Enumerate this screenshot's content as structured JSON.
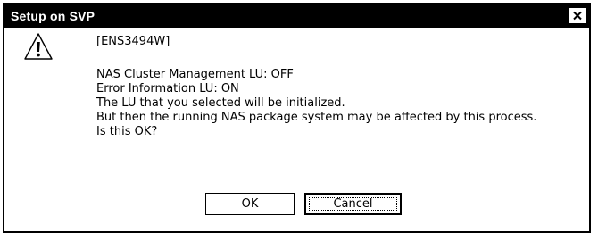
{
  "window": {
    "title": "Setup on SVP",
    "close_icon": "close-icon"
  },
  "message": {
    "icon": "warning-icon",
    "code": "[ENS3494W]",
    "lines": [
      "NAS Cluster Management LU: OFF",
      "Error Information LU: ON",
      "The LU that you selected will be initialized.",
      "But then the running NAS package system may be affected by this process.",
      "Is this OK?"
    ]
  },
  "buttons": {
    "ok_label": "OK",
    "cancel_label": "Cancel"
  },
  "colors": {
    "titlebar_bg": "#000000",
    "titlebar_text": "#ffffff",
    "dialog_bg": "#ffffff"
  }
}
